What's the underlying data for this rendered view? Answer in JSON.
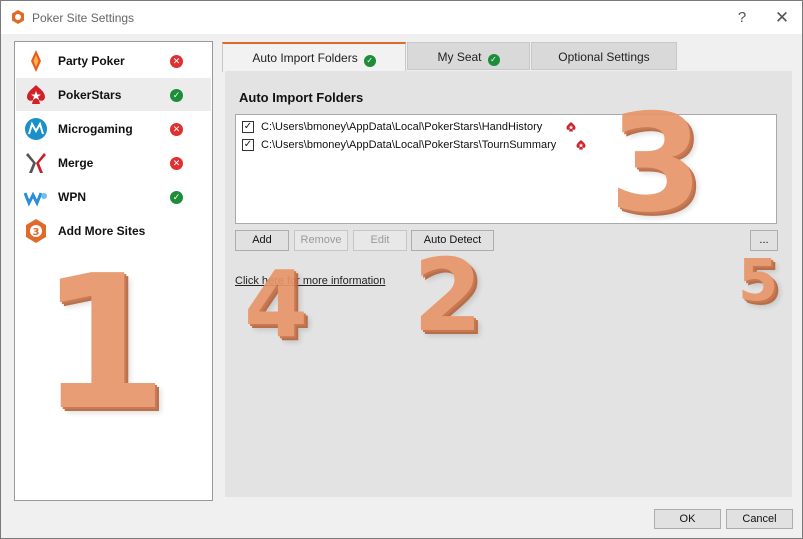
{
  "window": {
    "title": "Poker Site Settings",
    "help": "?",
    "close": "✕"
  },
  "sidebar": {
    "items": [
      {
        "label": "Party Poker",
        "status": "error"
      },
      {
        "label": "PokerStars",
        "status": "ok",
        "selected": true
      },
      {
        "label": "Microgaming",
        "status": "error"
      },
      {
        "label": "Merge",
        "status": "error"
      },
      {
        "label": "WPN",
        "status": "ok"
      },
      {
        "label": "Add More Sites"
      }
    ]
  },
  "tabs": [
    {
      "label": "Auto Import Folders",
      "status": "ok",
      "active": true
    },
    {
      "label": "My Seat",
      "status": "ok"
    },
    {
      "label": "Optional Settings"
    }
  ],
  "content": {
    "title": "Auto Import Folders",
    "folders": [
      {
        "checked": true,
        "path": "C:\\Users\\bmoney\\AppData\\Local\\PokerStars\\HandHistory"
      },
      {
        "checked": true,
        "path": "C:\\Users\\bmoney\\AppData\\Local\\PokerStars\\TournSummary"
      }
    ],
    "buttons": {
      "add": "Add",
      "remove": "Remove",
      "edit": "Edit",
      "auto_detect": "Auto Detect",
      "browse": "..."
    },
    "info_link": "Click here for more information"
  },
  "annotations": {
    "n1": "1",
    "n2": "2",
    "n3": "3",
    "n4": "4",
    "n5": "5"
  },
  "footer": {
    "ok": "OK",
    "cancel": "Cancel"
  },
  "colors": {
    "accent": "#e06a2a",
    "ok": "#1d8d3a",
    "error": "#e03030",
    "number": "#e8956a"
  }
}
